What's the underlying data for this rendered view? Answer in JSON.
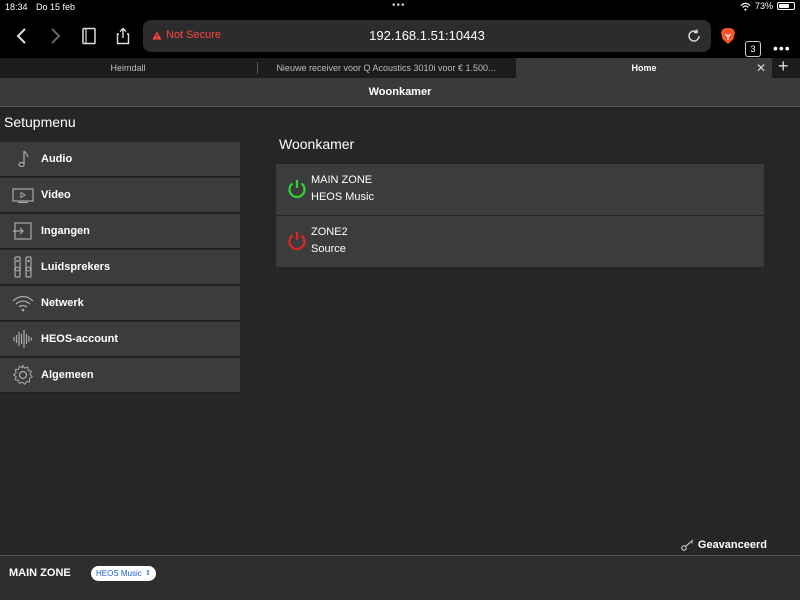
{
  "status_bar": {
    "time": "18:34",
    "date": "Do 15 feb",
    "battery": "73%",
    "battery_level": 0.73
  },
  "browser": {
    "security_label": "Not Secure",
    "url": "192.168.1.51:10443",
    "tab_count": "3",
    "tabs": [
      {
        "label": "Heimdall"
      },
      {
        "label": "Nieuwe receiver voor Q Acoustics 3010i voor € 1.500..."
      },
      {
        "label": "Home"
      }
    ],
    "colors": {
      "warning": "#ff453a",
      "brave": "#fb542b"
    }
  },
  "page": {
    "header_title": "Woonkamer",
    "setup_title": "Setupmenu",
    "menu": [
      {
        "label": "Audio",
        "icon": "music-note-icon"
      },
      {
        "label": "Video",
        "icon": "video-icon"
      },
      {
        "label": "Ingangen",
        "icon": "input-icon"
      },
      {
        "label": "Luidsprekers",
        "icon": "speakers-icon"
      },
      {
        "label": "Netwerk",
        "icon": "wifi-icon"
      },
      {
        "label": "HEOS-account",
        "icon": "heos-wave-icon"
      },
      {
        "label": "Algemeen",
        "icon": "gear-icon"
      }
    ],
    "zone_title": "Woonkamer",
    "zones": [
      {
        "name": "MAIN ZONE",
        "source": "HEOS Music",
        "power": "on",
        "color": "#2fd52f"
      },
      {
        "name": "ZONE2",
        "source": "Source",
        "power": "off",
        "color": "#e02424"
      }
    ],
    "advanced_label": "Geavanceerd"
  },
  "footer": {
    "zone": "MAIN ZONE",
    "source_selected": "HEOS Music"
  }
}
